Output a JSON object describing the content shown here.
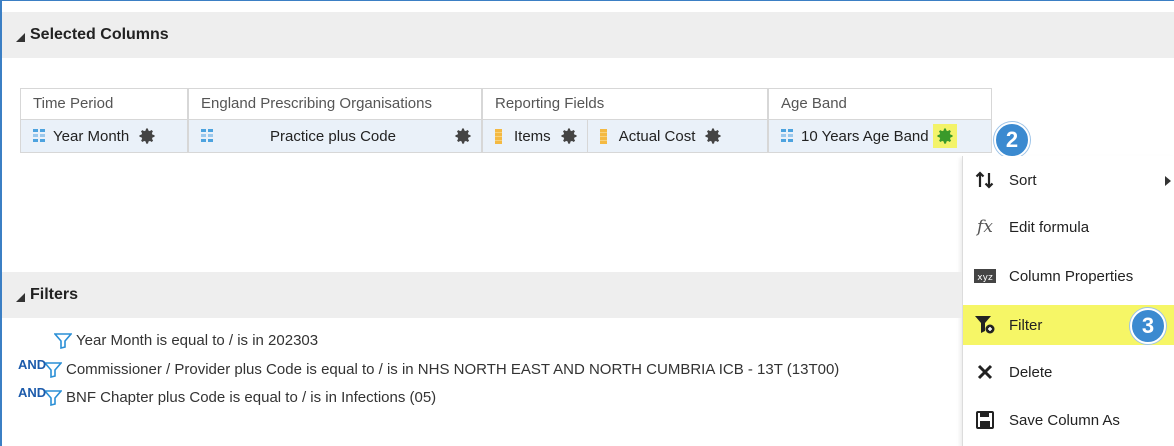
{
  "selected_columns": {
    "header": "Selected Columns",
    "groups": [
      {
        "title": "Time Period",
        "chips": [
          {
            "label": "Year Month",
            "icon": "attribute-icon"
          }
        ]
      },
      {
        "title": "England Prescribing Organisations",
        "chips": [
          {
            "label": "Practice plus Code",
            "icon": "attribute-icon"
          }
        ]
      },
      {
        "title": "Reporting Fields",
        "chips": [
          {
            "label": "Items",
            "icon": "measure-icon"
          },
          {
            "label": "Actual Cost",
            "icon": "measure-icon"
          }
        ]
      },
      {
        "title": "Age Band",
        "chips": [
          {
            "label": "10 Years Age Band",
            "icon": "attribute-icon"
          }
        ]
      }
    ]
  },
  "callouts": {
    "step2": "2",
    "step3": "3",
    "color": "#3b8ad0"
  },
  "context_menu": {
    "items": [
      {
        "label": "Sort",
        "icon": "sort-icon",
        "has_submenu": true
      },
      {
        "label": "Edit formula",
        "icon": "formula-icon"
      },
      {
        "label": "Column Properties",
        "icon": "column-properties-icon"
      },
      {
        "label": "Filter",
        "icon": "filter-icon",
        "highlighted": true
      },
      {
        "label": "Delete",
        "icon": "delete-icon"
      },
      {
        "label": "Save Column As",
        "icon": "save-icon"
      }
    ],
    "highlight_color": "#f6f666"
  },
  "filters": {
    "header": "Filters",
    "lines": [
      {
        "connector": "",
        "text": "Year Month is equal to / is in  202303"
      },
      {
        "connector": "AND",
        "text": "Commissioner / Provider plus Code is equal to / is in  NHS NORTH EAST AND NORTH CUMBRIA ICB - 13T (13T00)"
      },
      {
        "connector": "AND",
        "text": "BNF Chapter plus Code is equal to / is in  Infections (05)"
      }
    ]
  }
}
